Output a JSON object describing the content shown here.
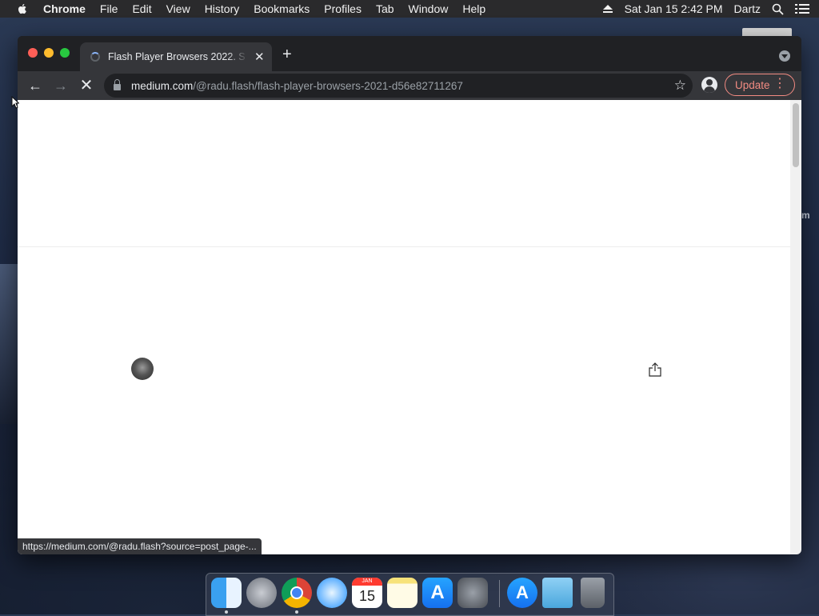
{
  "menubar": {
    "app_name": "Chrome",
    "items": [
      "File",
      "Edit",
      "View",
      "History",
      "Bookmarks",
      "Profiles",
      "Tab",
      "Window",
      "Help"
    ],
    "datetime": "Sat Jan 15  2:42 PM",
    "user": "Dartz"
  },
  "browser": {
    "tab_title": "Flash Player Browsers 2022. S",
    "url_host": "medium.com",
    "url_path": "/@radu.flash/flash-player-browsers-2021-d56e82711267",
    "update_label": "Update",
    "status_url": "https://medium.com/@radu.flash?source=post_page-..."
  },
  "desktop": {
    "side_text": "m"
  },
  "dock": {
    "apps": [
      "finder",
      "launchpad",
      "chrome",
      "safari",
      "calendar",
      "notes",
      "app-store",
      "system-preferences",
      "app-store-2",
      "downloads-folder",
      "trash"
    ],
    "calendar_day": "15",
    "calendar_month": "JAN"
  }
}
